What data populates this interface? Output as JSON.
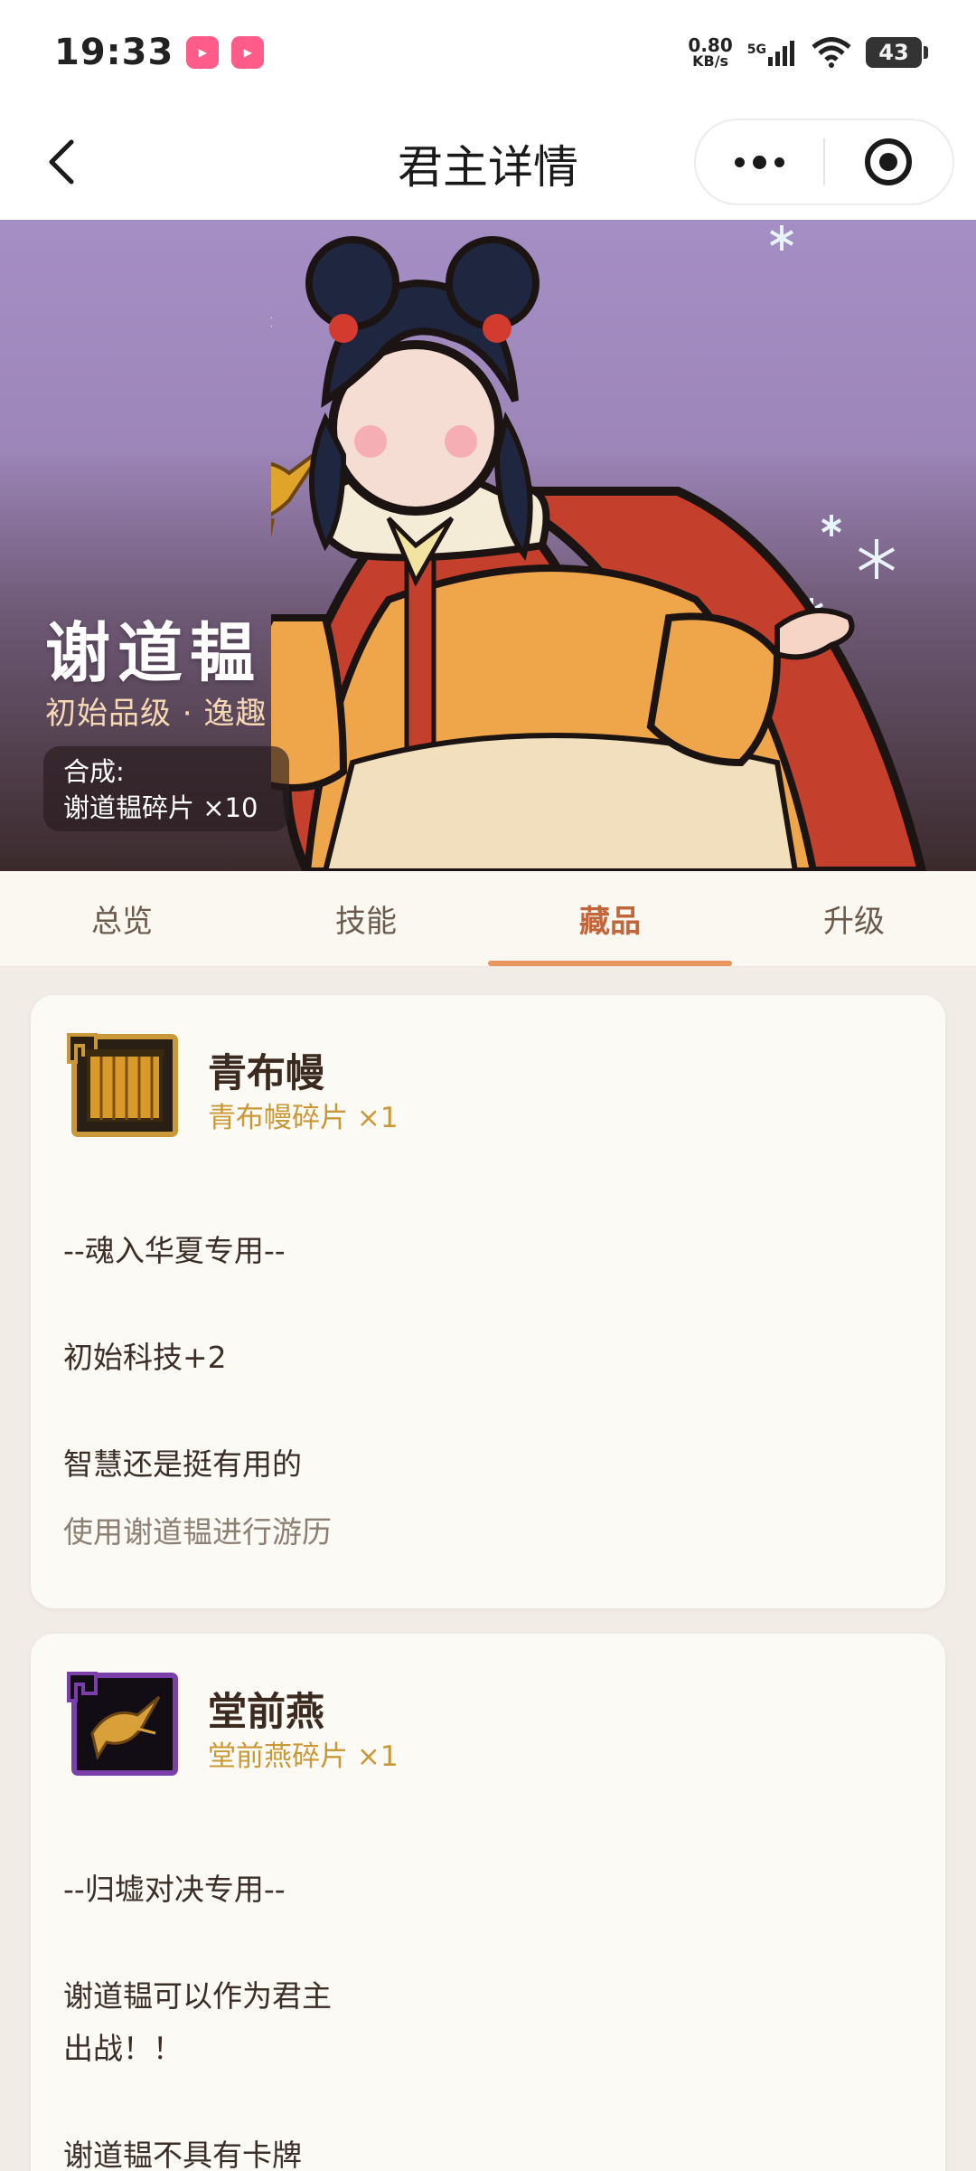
{
  "status_bar": {
    "time": "19:33",
    "app_badges": [
      "bilibili",
      "bilibili"
    ],
    "net_speed_value": "0.80",
    "net_speed_unit": "KB/s",
    "network": "5G",
    "battery": "43",
    "icons": [
      "signal-icon",
      "wifi-icon",
      "battery-icon"
    ]
  },
  "nav": {
    "title": "君主详情",
    "back_icon": "chevron-left-icon",
    "more_icon": "more-dots-icon",
    "close_icon": "target-circle-icon"
  },
  "hero": {
    "name": "谢道韫",
    "grade": "初始品级 · 逸趣",
    "synth_label": "合成:",
    "synth_value": "谢道韫碎片 ×10"
  },
  "tabs": [
    {
      "label": "总览",
      "active": false
    },
    {
      "label": "技能",
      "active": false
    },
    {
      "label": "藏品",
      "active": true
    },
    {
      "label": "升级",
      "active": false
    }
  ],
  "cards": [
    {
      "name": "青布幔",
      "fragment": "青布幔碎片 ×1",
      "icon": "blue-curtain-icon",
      "icon_color": "#c99838",
      "lines": [
        "--魂入华夏专用--",
        "初始科技+2",
        "智慧还是挺有用的"
      ],
      "hint": "使用谢道韫进行游历"
    },
    {
      "name": "堂前燕",
      "fragment": "堂前燕碎片 ×1",
      "icon": "swallow-icon",
      "icon_color": "#7a3fa8",
      "lines": [
        "--归墟对决专用--",
        "谢道韫可以作为君主",
        "出战！！",
        "谢道韫不具有卡牌"
      ]
    }
  ],
  "colors": {
    "accent": "#c0663a",
    "tab_underline": "#e7965f",
    "fragment_text": "#c99838",
    "hero_top": "#a58ec4",
    "hero_bottom": "#3b2a2c"
  }
}
